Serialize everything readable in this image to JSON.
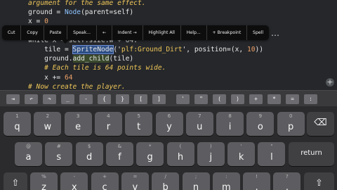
{
  "editor": {
    "lines": [
      [
        {
          "t": "argument for the same effect.",
          "c": "tok-comment"
        }
      ],
      [
        {
          "t": "ground = "
        },
        {
          "t": "Node",
          "c": "tok-call"
        },
        {
          "t": "(parent=self)"
        }
      ],
      [
        {
          "t": "x = "
        },
        {
          "t": "0",
          "c": "tok-num"
        }
      ],
      [
        {
          "t": ""
        }
      ],
      [
        {
          "t": "while x < self.size.w + 64:"
        }
      ],
      [
        {
          "t": "    tile = "
        },
        {
          "t": "SpriteNode",
          "c": "tok-sel"
        },
        {
          "t": "('"
        },
        {
          "t": "plf:Ground_Dirt",
          "c": "tok-str"
        },
        {
          "t": "', position=(x, "
        },
        {
          "t": "10",
          "c": "tok-num"
        },
        {
          "t": "))"
        }
      ],
      [
        {
          "t": "    ground."
        },
        {
          "t": "add_child",
          "c": "tok-hl"
        },
        {
          "t": "(tile)"
        }
      ],
      [
        {
          "t": "    "
        },
        {
          "t": "# Each tile is 64 points wide.",
          "c": "tok-comment"
        }
      ],
      [
        {
          "t": "    x += "
        },
        {
          "t": "64",
          "c": "tok-num"
        }
      ],
      [
        {
          "t": "# Now create the player.",
          "c": "tok-comment"
        }
      ]
    ],
    "scroll_plus": "+"
  },
  "context_menu": {
    "items": [
      "Cut",
      "Copy",
      "Paste",
      "Speak...",
      "←",
      "Indent →",
      "Highlight All",
      "Help...",
      "+ Breakpoint",
      "Spell"
    ],
    "more": "…"
  },
  "keyboard": {
    "extra_keys": [
      "⇥",
      "↶",
      "↷",
      "_",
      "-",
      "{",
      "}",
      "[",
      "]",
      "'",
      "\"",
      "(",
      ")",
      "+",
      "*",
      "=",
      ":"
    ],
    "row1": [
      {
        "main": "q",
        "sub": "1"
      },
      {
        "main": "w",
        "sub": "2"
      },
      {
        "main": "e",
        "sub": "3"
      },
      {
        "main": "r",
        "sub": "4"
      },
      {
        "main": "t",
        "sub": "5"
      },
      {
        "main": "y",
        "sub": "6"
      },
      {
        "main": "u",
        "sub": "7"
      },
      {
        "main": "i",
        "sub": "8"
      },
      {
        "main": "o",
        "sub": "9"
      },
      {
        "main": "p",
        "sub": "0"
      }
    ],
    "row2": [
      {
        "main": "a",
        "sub": "@"
      },
      {
        "main": "s",
        "sub": "#"
      },
      {
        "main": "d",
        "sub": "$"
      },
      {
        "main": "f",
        "sub": "&"
      },
      {
        "main": "g",
        "sub": "*"
      },
      {
        "main": "h",
        "sub": "("
      },
      {
        "main": "j",
        "sub": ")"
      },
      {
        "main": "k",
        "sub": "'"
      },
      {
        "main": "l",
        "sub": "\""
      }
    ],
    "row3": [
      {
        "main": "z",
        "sub": "%"
      },
      {
        "main": "x",
        "sub": "-"
      },
      {
        "main": "c",
        "sub": "+"
      },
      {
        "main": "v",
        "sub": "="
      },
      {
        "main": "b",
        "sub": "/"
      },
      {
        "main": "n",
        "sub": ";"
      },
      {
        "main": "m",
        "sub": ":"
      },
      {
        "main": ",",
        "sub": "!"
      },
      {
        "main": ".",
        "sub": "?"
      }
    ],
    "backspace": "⌫",
    "return": "return",
    "shift": "⇧"
  }
}
